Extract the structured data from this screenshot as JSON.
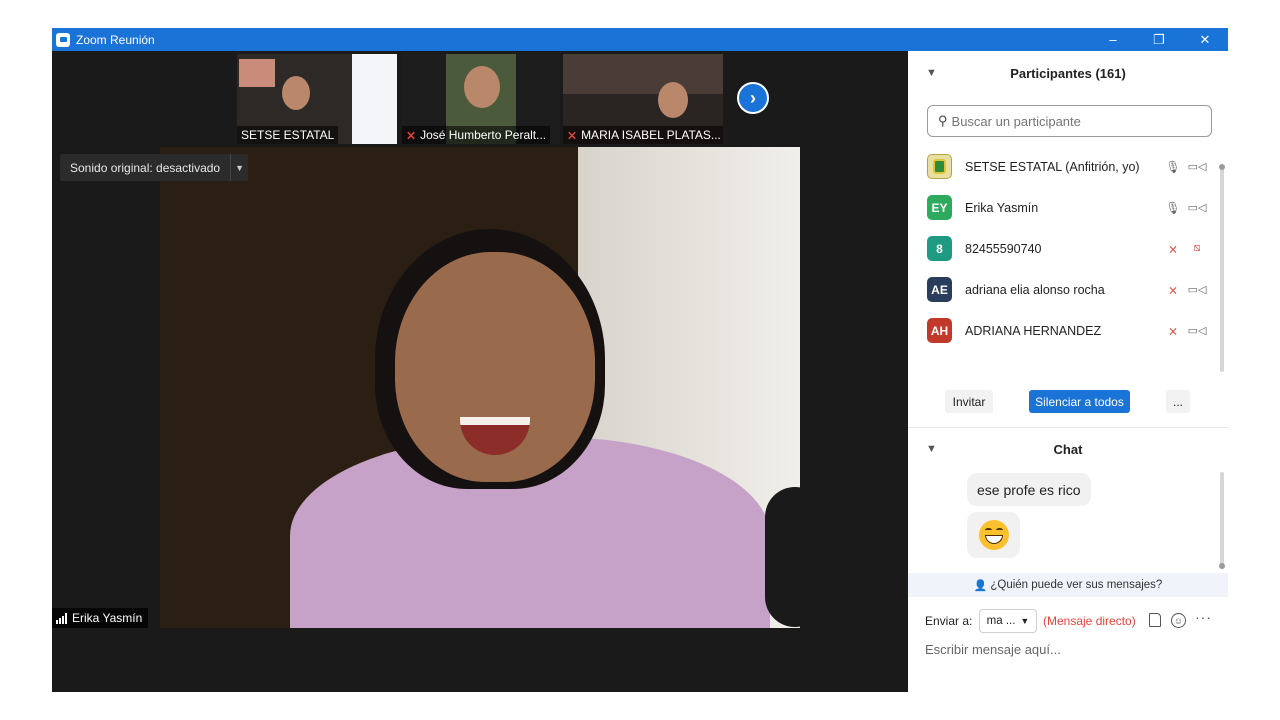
{
  "window": {
    "title": "Zoom Reunión",
    "minimize_glyph": "–",
    "maximize_glyph": "❐",
    "close_glyph": "✕"
  },
  "gallery": {
    "thumbnails": [
      {
        "name": "SETSE ESTATAL",
        "muted": false
      },
      {
        "name": "José Humberto Peralt...",
        "muted": true
      },
      {
        "name": "MARIA ISABEL PLATAS...",
        "muted": true
      }
    ],
    "next_glyph": "›"
  },
  "main_video": {
    "audio_option": "Sonido original: desactivado",
    "speaker_name": "Erika Yasmín"
  },
  "participants": {
    "title": "Participantes (161)",
    "search_placeholder": "Buscar un participante",
    "list": [
      {
        "initials": "",
        "name": "SETSE ESTATAL (Anfitrión, yo)",
        "avatar_color": "#e8e0a0",
        "mic_muted": false,
        "video_off": false
      },
      {
        "initials": "EY",
        "name": "Erika Yasmín",
        "avatar_color": "#2eaa5e",
        "mic_muted": false,
        "video_off": false
      },
      {
        "initials": "8",
        "name": "82455590740",
        "avatar_color": "#1f9a82",
        "mic_muted": true,
        "video_off": true
      },
      {
        "initials": "AE",
        "name": "adriana elia alonso rocha",
        "avatar_color": "#2a3d5c",
        "mic_muted": true,
        "video_off": false
      },
      {
        "initials": "AH",
        "name": "ADRIANA HERNANDEZ",
        "avatar_color": "#c0392b",
        "mic_muted": true,
        "video_off": false
      }
    ],
    "invite_label": "Invitar",
    "mute_all_label": "Silenciar a todos",
    "more_label": "..."
  },
  "chat": {
    "title": "Chat",
    "messages": [
      {
        "text": "ese profe es rico"
      },
      {
        "emoji": "grinning-face"
      }
    ],
    "privacy_text": "¿Quién puede ver sus mensajes?",
    "send_to_label": "Enviar a:",
    "recipient": "ma ...",
    "direct_label": "(Mensaje directo)",
    "message_placeholder": "Escribir mensaje aquí..."
  },
  "colors": {
    "accent": "#1a73d6",
    "muted_red": "#e0453a",
    "video_bg": "#1a1a1a"
  }
}
